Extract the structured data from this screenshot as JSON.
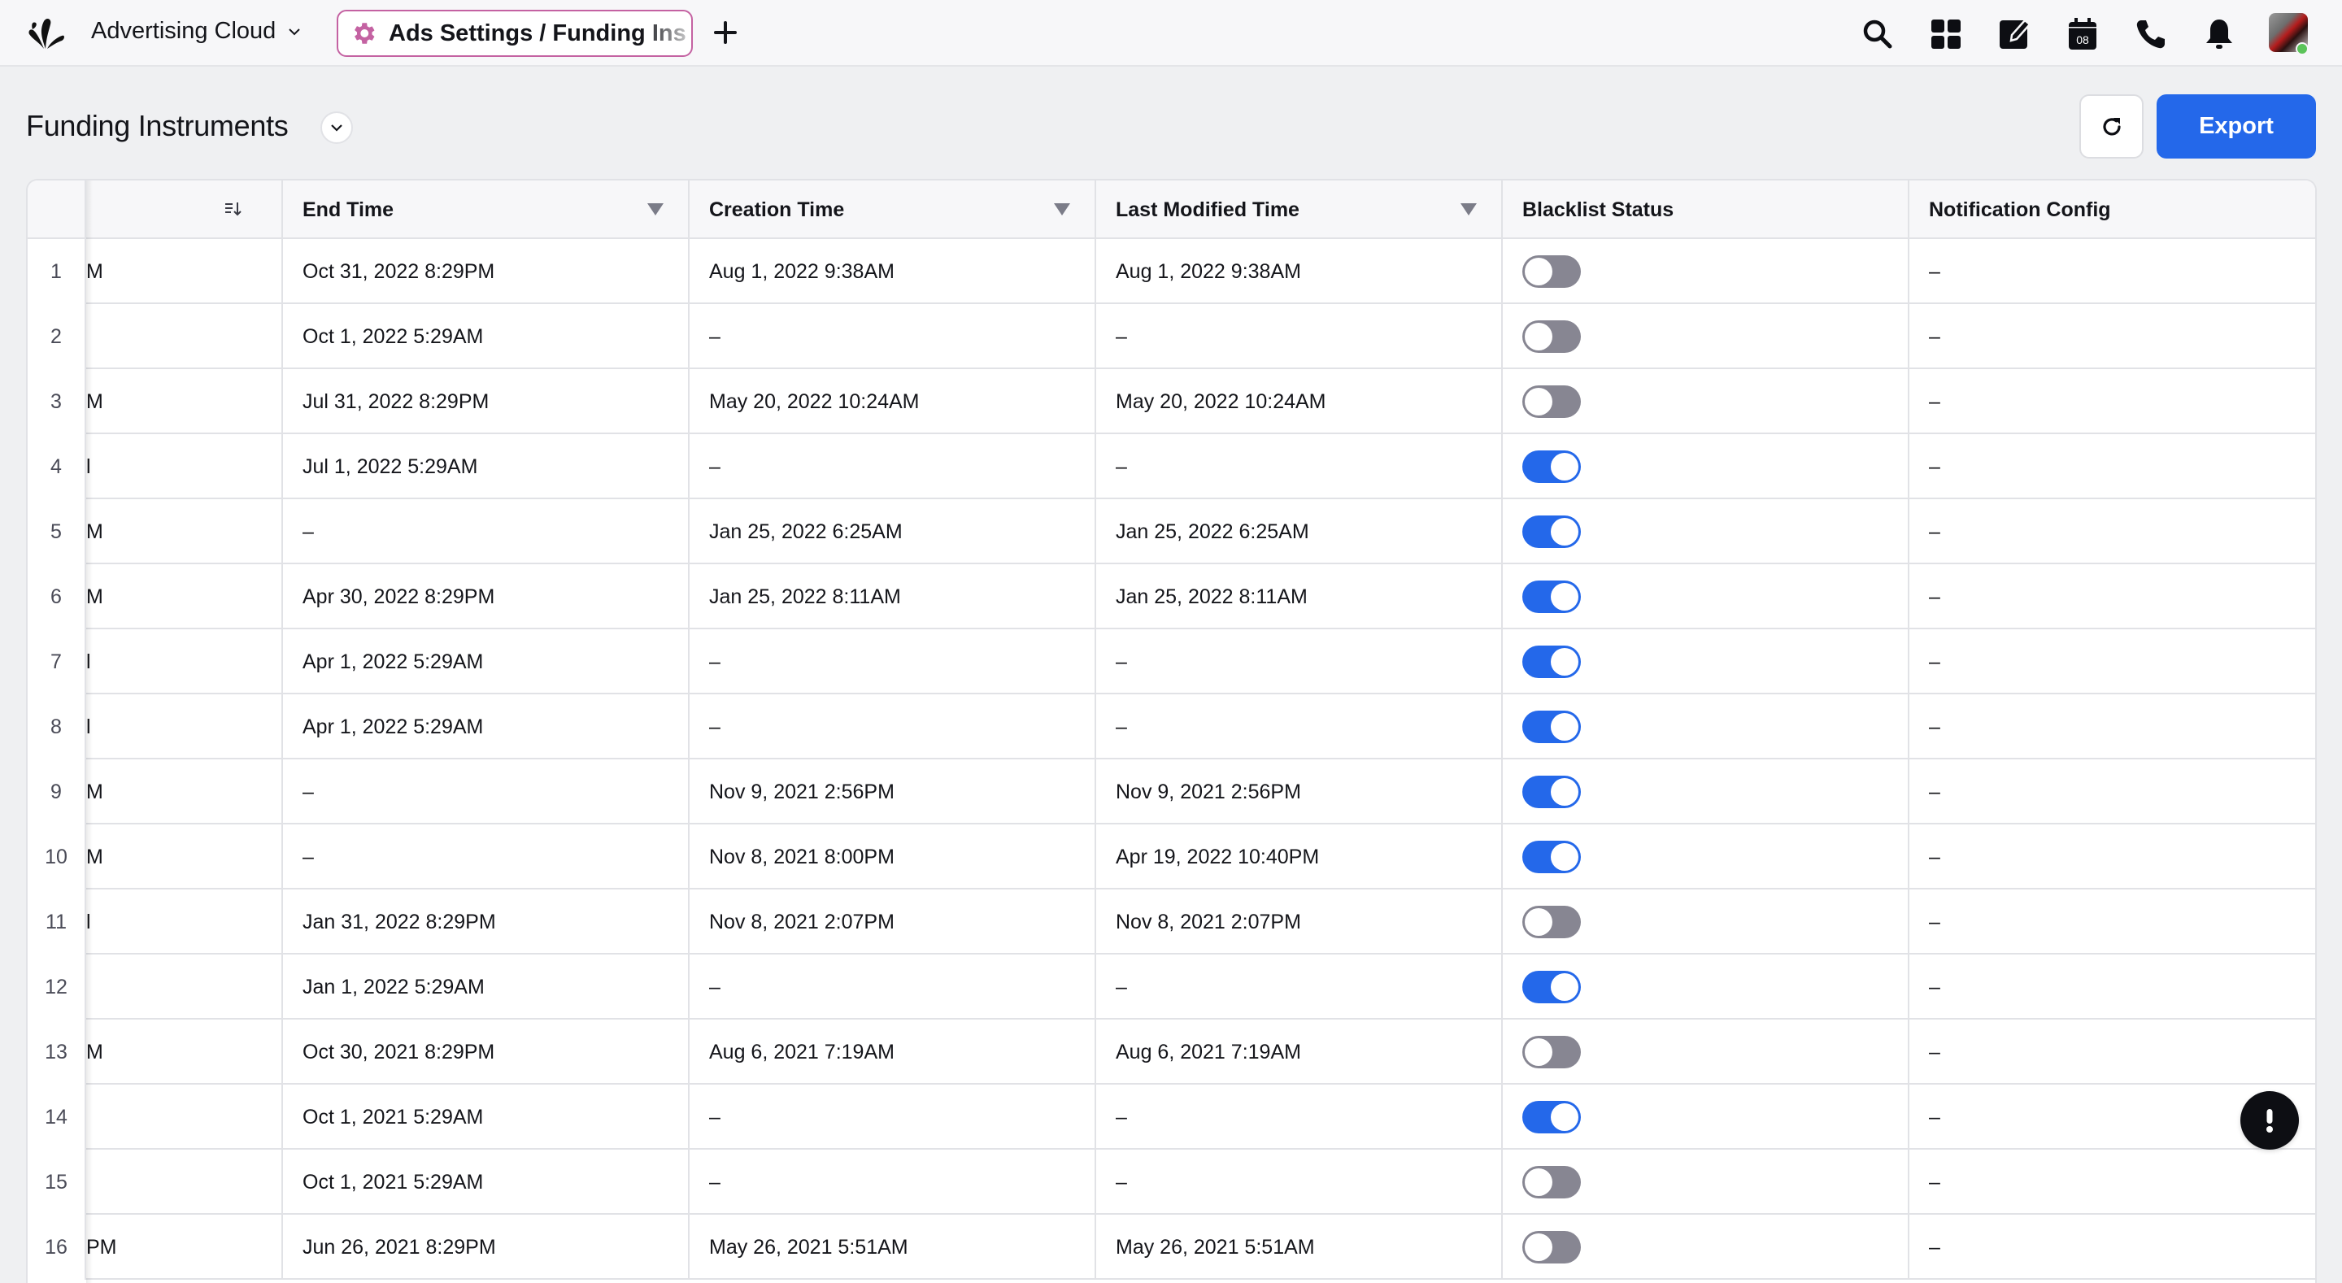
{
  "topbar": {
    "logo_icon": "sprinklr-logo-icon",
    "app_name": "Advertising Cloud",
    "active_tab_label": "Ads Settings / Funding Ins",
    "tab_accent_color": "#c462a2",
    "icons": [
      "search-icon",
      "grid-apps-icon",
      "compose-icon",
      "calendar-icon",
      "phone-icon",
      "bell-icon"
    ],
    "calendar_day": "08",
    "presence_color": "#5cc45a"
  },
  "page": {
    "title": "Funding Instruments",
    "export_label": "Export",
    "accent_color": "#2468ea"
  },
  "table": {
    "columns": [
      {
        "key": "truncated",
        "label": ""
      },
      {
        "key": "end_time",
        "label": "End Time"
      },
      {
        "key": "creation_time",
        "label": "Creation Time"
      },
      {
        "key": "last_modified_time",
        "label": "Last Modified Time"
      },
      {
        "key": "blacklist_status",
        "label": "Blacklist Status"
      },
      {
        "key": "notification_config",
        "label": "Notification Config"
      }
    ],
    "rows": [
      {
        "num": "1",
        "truncated": "M",
        "end_time": "Oct 31, 2022 8:29PM",
        "creation_time": "Aug 1, 2022 9:38AM",
        "last_modified_time": "Aug 1, 2022 9:38AM",
        "blacklisted": false,
        "notification_config": "–"
      },
      {
        "num": "2",
        "truncated": "",
        "end_time": "Oct 1, 2022 5:29AM",
        "creation_time": "–",
        "last_modified_time": "–",
        "blacklisted": false,
        "notification_config": "–"
      },
      {
        "num": "3",
        "truncated": "M",
        "end_time": "Jul 31, 2022 8:29PM",
        "creation_time": "May 20, 2022 10:24AM",
        "last_modified_time": "May 20, 2022 10:24AM",
        "blacklisted": false,
        "notification_config": "–"
      },
      {
        "num": "4",
        "truncated": "l",
        "end_time": "Jul 1, 2022 5:29AM",
        "creation_time": "–",
        "last_modified_time": "–",
        "blacklisted": true,
        "notification_config": "–"
      },
      {
        "num": "5",
        "truncated": "M",
        "end_time": "–",
        "creation_time": "Jan 25, 2022 6:25AM",
        "last_modified_time": "Jan 25, 2022 6:25AM",
        "blacklisted": true,
        "notification_config": "–"
      },
      {
        "num": "6",
        "truncated": "M",
        "end_time": "Apr 30, 2022 8:29PM",
        "creation_time": "Jan 25, 2022 8:11AM",
        "last_modified_time": "Jan 25, 2022 8:11AM",
        "blacklisted": true,
        "notification_config": "–"
      },
      {
        "num": "7",
        "truncated": "l",
        "end_time": "Apr 1, 2022 5:29AM",
        "creation_time": "–",
        "last_modified_time": "–",
        "blacklisted": true,
        "notification_config": "–"
      },
      {
        "num": "8",
        "truncated": "l",
        "end_time": "Apr 1, 2022 5:29AM",
        "creation_time": "–",
        "last_modified_time": "–",
        "blacklisted": true,
        "notification_config": "–"
      },
      {
        "num": "9",
        "truncated": "M",
        "end_time": "–",
        "creation_time": "Nov 9, 2021 2:56PM",
        "last_modified_time": "Nov 9, 2021 2:56PM",
        "blacklisted": true,
        "notification_config": "–"
      },
      {
        "num": "10",
        "truncated": "M",
        "end_time": "–",
        "creation_time": "Nov 8, 2021 8:00PM",
        "last_modified_time": "Apr 19, 2022 10:40PM",
        "blacklisted": true,
        "notification_config": "–"
      },
      {
        "num": "11",
        "truncated": "l",
        "end_time": "Jan 31, 2022 8:29PM",
        "creation_time": "Nov 8, 2021 2:07PM",
        "last_modified_time": "Nov 8, 2021 2:07PM",
        "blacklisted": false,
        "notification_config": "–"
      },
      {
        "num": "12",
        "truncated": "",
        "end_time": "Jan 1, 2022 5:29AM",
        "creation_time": "–",
        "last_modified_time": "–",
        "blacklisted": true,
        "notification_config": "–"
      },
      {
        "num": "13",
        "truncated": "M",
        "end_time": "Oct 30, 2021 8:29PM",
        "creation_time": "Aug 6, 2021 7:19AM",
        "last_modified_time": "Aug 6, 2021 7:19AM",
        "blacklisted": false,
        "notification_config": "–"
      },
      {
        "num": "14",
        "truncated": "",
        "end_time": "Oct 1, 2021 5:29AM",
        "creation_time": "–",
        "last_modified_time": "–",
        "blacklisted": true,
        "notification_config": "–"
      },
      {
        "num": "15",
        "truncated": "",
        "end_time": "Oct 1, 2021 5:29AM",
        "creation_time": "–",
        "last_modified_time": "–",
        "blacklisted": false,
        "notification_config": "–"
      },
      {
        "num": "16",
        "truncated": "PM",
        "end_time": "Jun 26, 2021 8:29PM",
        "creation_time": "May 26, 2021 5:51AM",
        "last_modified_time": "May 26, 2021 5:51AM",
        "blacklisted": false,
        "notification_config": "–"
      }
    ]
  },
  "floating_button_icon": "alert-exclamation-icon"
}
